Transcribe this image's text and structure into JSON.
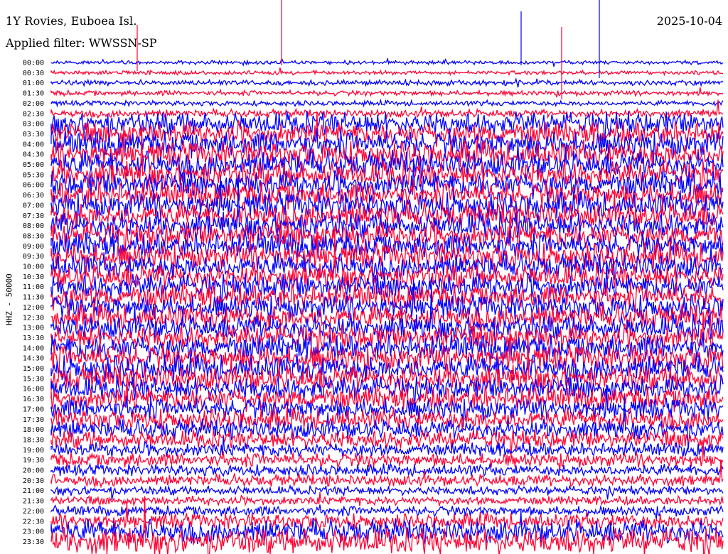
{
  "header": {
    "station": "1Y Rovies, Euboea Isl.",
    "date": "2025-10-04",
    "filter": "Applied filter: WWSSN-SP",
    "channel": "HHZ - 50000"
  },
  "colors": {
    "trace_a": "#0000ff",
    "trace_b": "#ff0033",
    "background": "#ffffff"
  },
  "chart_data": {
    "type": "line",
    "title": "1Y Rovies, Euboea Isl.",
    "ylabel": "HHZ - 50000",
    "rows": [
      "00:00",
      "00:30",
      "01:00",
      "01:30",
      "02:00",
      "02:30",
      "03:00",
      "03:30",
      "04:00",
      "04:30",
      "05:00",
      "05:30",
      "06:00",
      "06:30",
      "07:00",
      "07:30",
      "08:00",
      "08:30",
      "09:00",
      "09:30",
      "10:00",
      "10:30",
      "11:00",
      "11:30",
      "12:00",
      "12:30",
      "13:00",
      "13:30",
      "14:00",
      "14:30",
      "15:00",
      "15:30",
      "16:00",
      "16:30",
      "17:00",
      "17:30",
      "18:00",
      "18:30",
      "19:00",
      "19:30",
      "20:00",
      "20:30",
      "21:00",
      "21:30",
      "22:00",
      "22:30",
      "23:00",
      "23:30"
    ],
    "series_colors": [
      "#0000ff",
      "#ff0033"
    ],
    "relative_amplitude": [
      0.15,
      0.15,
      0.2,
      0.2,
      0.2,
      0.3,
      0.9,
      0.9,
      1.0,
      1.0,
      1.0,
      1.0,
      1.0,
      1.0,
      1.0,
      1.0,
      1.0,
      1.0,
      1.0,
      1.0,
      0.95,
      0.95,
      0.95,
      0.95,
      0.95,
      0.95,
      0.95,
      0.95,
      1.0,
      1.0,
      1.0,
      1.0,
      0.9,
      0.9,
      0.85,
      0.8,
      0.75,
      0.7,
      0.55,
      0.55,
      0.45,
      0.45,
      0.35,
      0.35,
      0.4,
      0.6,
      0.9,
      1.0
    ],
    "grid": false
  }
}
